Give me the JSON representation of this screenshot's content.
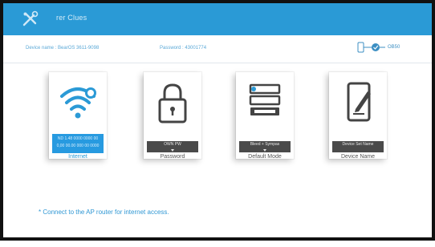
{
  "app": {
    "title": "rer Clues",
    "brand_color": "#2a9ad6"
  },
  "infobar": {
    "device_name": "Device name : BearOS 3611-9098",
    "password": "Password : 43001774",
    "status_text": "OB50"
  },
  "cards": [
    {
      "icon": "wifi-icon",
      "button_line1": "ND  1.48 0000 0000 00",
      "button_line2": "0,00 00.00 000 00 0000",
      "caption": "Internet"
    },
    {
      "icon": "lock-icon",
      "button_line1": "OWN PW",
      "caption": "Password"
    },
    {
      "icon": "modes-icon",
      "button_line1": "Bleed + Sympas",
      "caption": "Default Mode"
    },
    {
      "icon": "edit-device-icon",
      "button_line1": "Device Set Name",
      "caption": "Device Name"
    }
  ],
  "notice": "* Connect to the AP router for internet access."
}
